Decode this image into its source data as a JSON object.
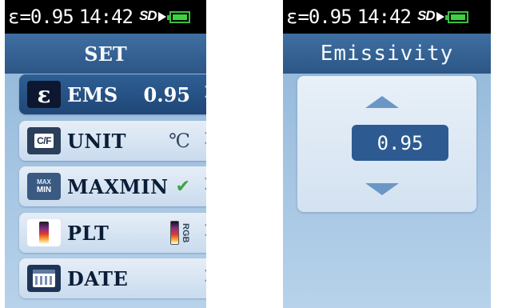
{
  "left_screen": {
    "status": {
      "epsilon_symbol": "ε",
      "emissivity": "=0.95",
      "time": "14:42",
      "sd_label": "SD",
      "sd_icon": "sd-card-icon",
      "battery_icon": "battery-full-icon"
    },
    "title": "SET",
    "items": [
      {
        "icon": "epsilon-icon",
        "icon_text": "ε",
        "label": "EMS",
        "value": "0.95",
        "selected": true
      },
      {
        "icon": "celsius-fahrenheit-icon",
        "icon_text": "C/F",
        "label": "UNIT",
        "value": "℃"
      },
      {
        "icon": "max-min-icon",
        "icon_text_top": "MAX",
        "icon_text_bottom": "MIN",
        "label": "MAXMIN",
        "value": "✔"
      },
      {
        "icon": "palette-icon",
        "label": "PLT",
        "value": "RGB"
      },
      {
        "icon": "calendar-icon",
        "label": "DATE",
        "value": ""
      }
    ]
  },
  "right_screen": {
    "status": {
      "epsilon_symbol": "ε",
      "emissivity": "=0.95",
      "time": "14:42",
      "sd_label": "SD",
      "sd_icon": "sd-card-icon",
      "battery_icon": "battery-full-icon"
    },
    "title": "Emissivity",
    "value": "0.95"
  },
  "colors": {
    "header": "#2c5685",
    "selected": "#1f4676",
    "background": "#b7d2ea",
    "check": "#3fa33f",
    "battery": "#3fd23f"
  }
}
